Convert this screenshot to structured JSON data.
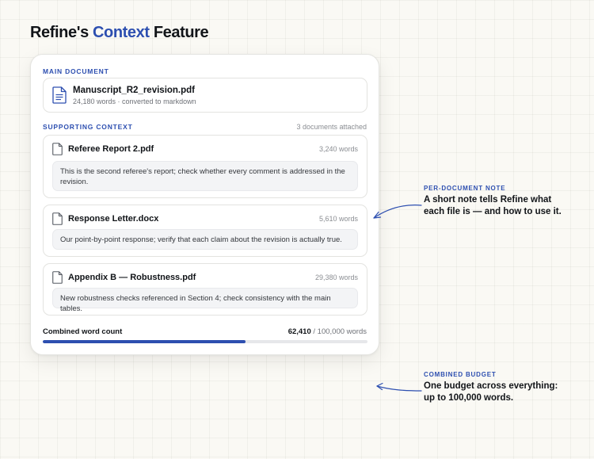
{
  "page_title": {
    "prefix": "Refine's",
    "accent": "Context",
    "suffix": "Feature"
  },
  "main_document": {
    "section_label": "MAIN DOCUMENT",
    "file_name": "Manuscript_R2_revision.pdf",
    "meta": "24,180 words · converted to markdown",
    "icon": "document-icon"
  },
  "supporting_context": {
    "section_label": "SUPPORTING CONTEXT",
    "attached_count": "3 documents attached",
    "files": [
      {
        "name": "Referee Report 2.pdf",
        "words": "3,240 words",
        "note": "This is the second referee's report; check whether every comment is addressed in the revision.",
        "icon": "file-icon"
      },
      {
        "name": "Response Letter.docx",
        "words": "5,610 words",
        "note": "Our point-by-point response; verify that each claim about the revision is actually true.",
        "icon": "file-icon"
      },
      {
        "name": "Appendix B — Robustness.pdf",
        "words": "29,380 words",
        "note": "New robustness checks referenced in Section 4; check consistency with the main tables.",
        "icon": "file-icon"
      }
    ]
  },
  "combined": {
    "label": "Combined word count",
    "current": "62,410",
    "limit": " / 100,000 words",
    "progress": 0.6241
  },
  "annotations": {
    "per_document_note": {
      "label": "PER-DOCUMENT NOTE",
      "text": "A short note tells Refine what each file is — and how to use it."
    },
    "combined_budget": {
      "label": "COMBINED BUDGET",
      "text": "One budget across everything: up to 100,000 words."
    }
  },
  "colors": {
    "accent": "#2d4fb0",
    "background": "#faf9f4",
    "card": "#ffffff",
    "note_background": "#f3f4f6",
    "progress_track": "#e6e7ea"
  }
}
